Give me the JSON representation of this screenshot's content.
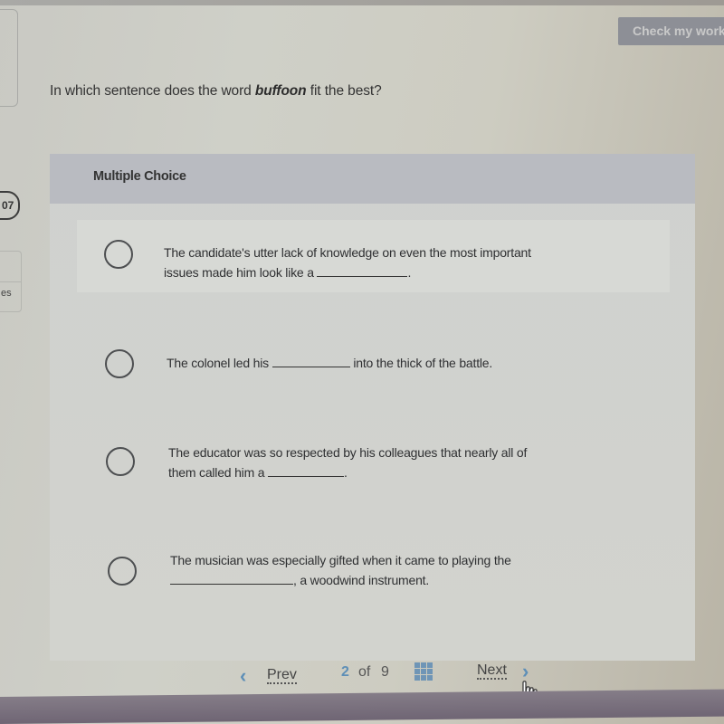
{
  "header": {
    "check_work_label": "Check my work"
  },
  "question": {
    "prefix": "In which sentence does the word ",
    "keyword": "buffoon",
    "suffix": " fit the best?"
  },
  "sidebar": {
    "score_partial": "07",
    "card_label_partial": "es"
  },
  "multiple_choice": {
    "header": "Multiple Choice",
    "options": [
      {
        "text_line1": "The candidate's utter lack of knowledge on even the most important",
        "text_line2_before": "issues made him look like a ",
        "text_line2_after": ".",
        "selected": false
      },
      {
        "text_before": "The colonel led his ",
        "text_after": " into the thick of the battle.",
        "selected": false
      },
      {
        "text_line1": "The educator was so respected by his colleagues that nearly all of",
        "text_line2_before": "them called him a ",
        "text_line2_after": ".",
        "selected": false
      },
      {
        "text_line1": "The musician was especially gifted when it came to playing the",
        "text_line2_before": "",
        "text_line2_after": ", a woodwind instrument.",
        "selected": false
      }
    ]
  },
  "pagination": {
    "prev_label": "Prev",
    "current_page": "2",
    "of_label": "of",
    "total_pages": "9",
    "next_label": "Next"
  },
  "colors": {
    "accent": "#5e8fb7",
    "check_button_bg": "#8d8f96",
    "panel_header_bg": "#b9bbc1"
  }
}
